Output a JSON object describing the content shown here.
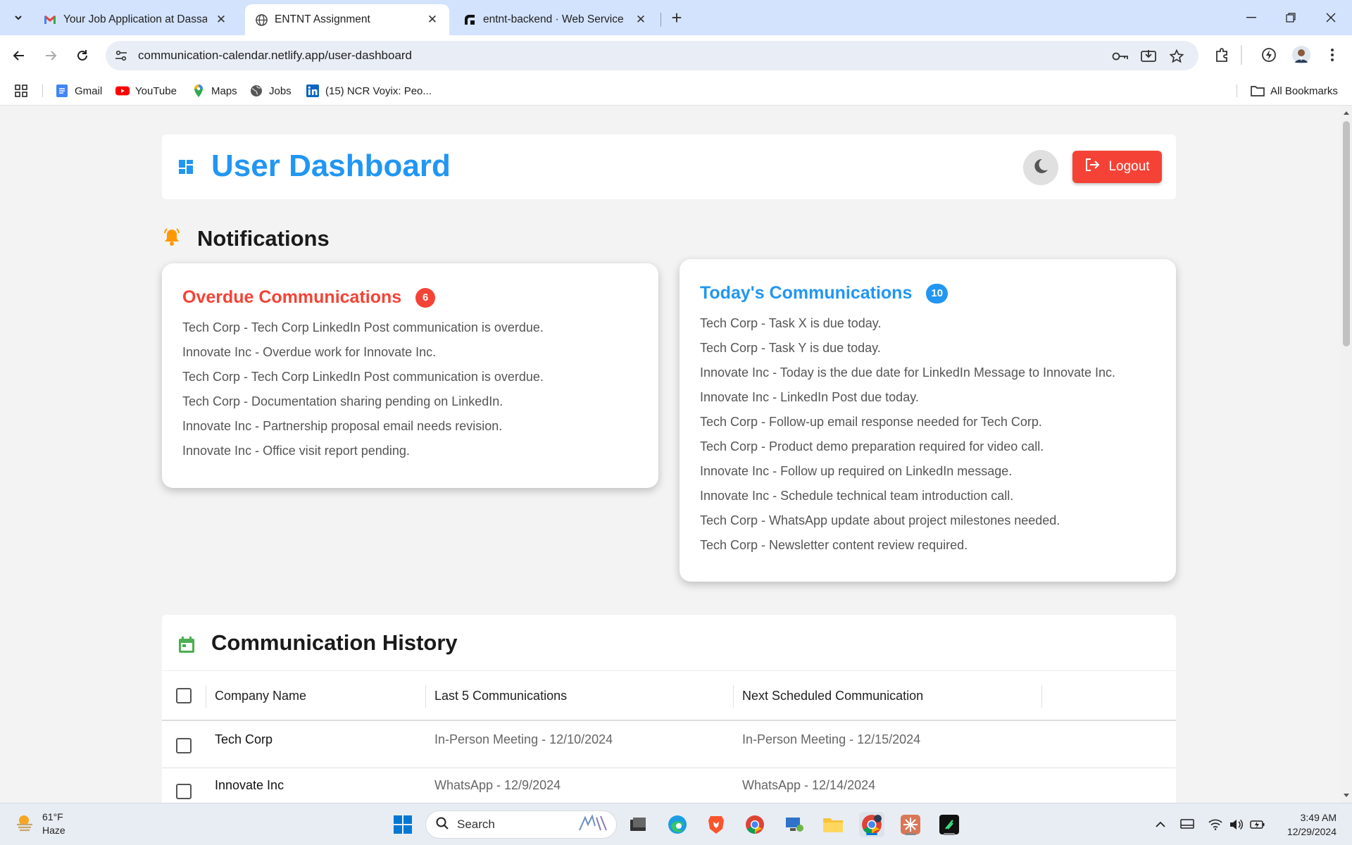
{
  "browser": {
    "tabs": [
      {
        "title": "Your Job Application at Dassault",
        "icon": "gmail-icon",
        "active": false
      },
      {
        "title": "ENTNT Assignment",
        "icon": "globe-icon",
        "active": true
      },
      {
        "title": "entnt-backend · Web Service",
        "icon": "render-icon",
        "active": false
      }
    ],
    "new_tab": "+",
    "url": "communication-calendar.netlify.app/user-dashboard",
    "bookmarks": [
      {
        "label": "Gmail",
        "icon": "gmail-doc-icon"
      },
      {
        "label": "YouTube",
        "icon": "youtube-icon"
      },
      {
        "label": "Maps",
        "icon": "maps-icon"
      },
      {
        "label": "Jobs",
        "icon": "globe-icon"
      },
      {
        "label": "(15) NCR Voyix: Peo...",
        "icon": "linkedin-icon"
      }
    ],
    "all_bookmarks": "All Bookmarks"
  },
  "header": {
    "title": "User Dashboard",
    "logout_label": "Logout",
    "theme_icon": "moon-icon"
  },
  "notifications": {
    "heading": "Notifications",
    "overdue": {
      "title": "Overdue Communications",
      "count": "6",
      "color": "#f44336",
      "items": [
        "Tech Corp - Tech Corp LinkedIn Post communication is overdue.",
        "Innovate Inc - Overdue work for Innovate Inc.",
        "Tech Corp - Tech Corp LinkedIn Post communication is overdue.",
        "Tech Corp - Documentation sharing pending on LinkedIn.",
        "Innovate Inc - Partnership proposal email needs revision.",
        "Innovate Inc - Office visit report pending."
      ]
    },
    "today": {
      "title": "Today's Communications",
      "count": "10",
      "color": "#2196f3",
      "items": [
        "Tech Corp - Task X is due today.",
        "Tech Corp - Task Y is due today.",
        "Innovate Inc - Today is the due date for LinkedIn Message to Innovate Inc.",
        "Innovate Inc - LinkedIn Post due today.",
        "Tech Corp - Follow-up email response needed for Tech Corp.",
        "Tech Corp - Product demo preparation required for video call.",
        "Innovate Inc - Follow up required on LinkedIn message.",
        "Innovate Inc - Schedule technical team introduction call.",
        "Tech Corp - WhatsApp update about project milestones needed.",
        "Tech Corp - Newsletter content review required."
      ]
    }
  },
  "history": {
    "title": "Communication History",
    "columns": [
      "Company Name",
      "Last 5 Communications",
      "Next Scheduled Communication"
    ],
    "rows": [
      {
        "company": "Tech Corp",
        "last": "In-Person Meeting - 12/10/2024",
        "next": "In-Person Meeting - 12/15/2024"
      },
      {
        "company": "Innovate Inc",
        "last": "WhatsApp - 12/9/2024",
        "next": "WhatsApp - 12/14/2024"
      }
    ]
  },
  "taskbar": {
    "temperature": "61°F",
    "condition": "Haze",
    "search_placeholder": "Search",
    "time": "3:49 AM",
    "date": "12/29/2024"
  }
}
